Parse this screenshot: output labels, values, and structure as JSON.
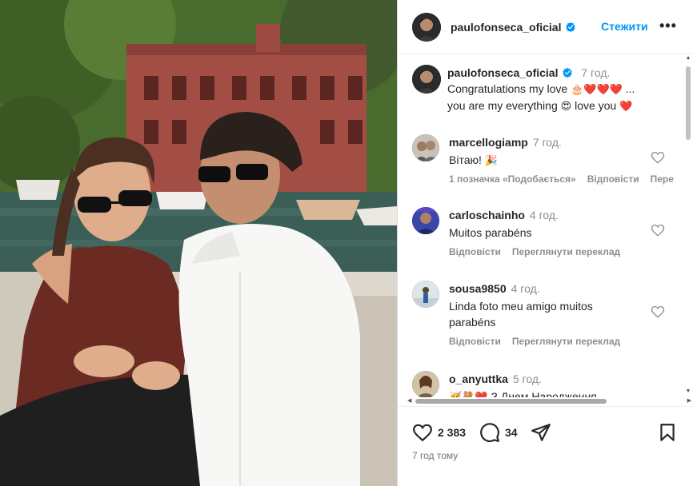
{
  "post": {
    "author": "paulofonseca_oficial",
    "follow_label": "Стежити",
    "more_label": "•••",
    "time_ago_footer": "7 год тому"
  },
  "caption": {
    "author": "paulofonseca_oficial",
    "time": "7 год.",
    "text_line1": "Congratulations my love",
    "text_line1_end": "...",
    "text_line2": "you are my everything",
    "text_line2_end": "love you"
  },
  "comments": [
    {
      "user": "marcellogiamp",
      "time": "7 год.",
      "text": "Вітаю!",
      "likes": "1 позначка «Подобається»",
      "reply": "Відповісти",
      "extra": "Пере"
    },
    {
      "user": "carloschainho",
      "time": "4 год.",
      "text": "Muitos parabéns",
      "reply": "Відповісти",
      "translate": "Переглянути переклад"
    },
    {
      "user": "sousa9850",
      "time": "4 год.",
      "text_line1": "Linda foto meu amigo muitos",
      "text_line2": "parabéns",
      "reply": "Відповісти",
      "translate": "Переглянути переклад"
    },
    {
      "user": "o_anyuttka",
      "time": "5 год.",
      "text": "З Днем Народження"
    }
  ],
  "stats": {
    "likes": "2 383",
    "comments": "34"
  },
  "icons": {
    "verified": "verified-badge-icon",
    "like": "heart-icon",
    "comment": "comment-bubble-icon",
    "share": "paper-plane-icon",
    "save": "bookmark-icon"
  },
  "colors": {
    "accent": "#0095f6",
    "text": "#262626",
    "muted": "#8e8e8e",
    "heart": "#e0245e"
  }
}
